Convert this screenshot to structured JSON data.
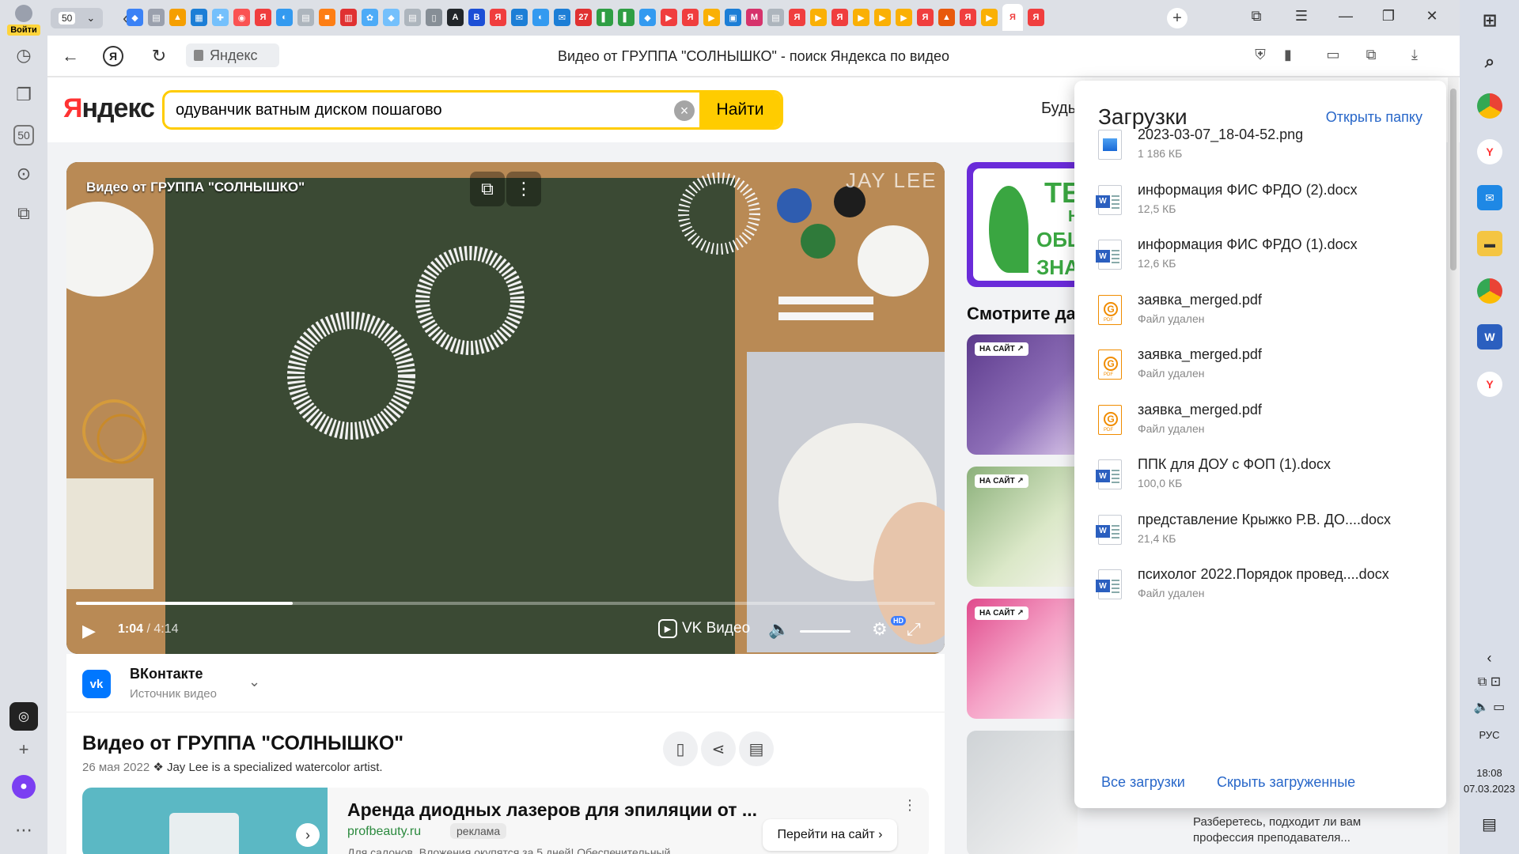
{
  "browser": {
    "login_label": "Войти",
    "tab_count": "50",
    "address_chip": "Яндекс",
    "page_title": "Видео от ГРУППА \"СОЛНЫШКО\" - поиск Яндекса по видео",
    "tab_icons": [
      {
        "name": "tab-icon-1",
        "color": "#3b82f6",
        "glyph": "◆"
      },
      {
        "name": "tab-icon-2",
        "color": "#9aa0ad",
        "glyph": "▤"
      },
      {
        "name": "tab-icon-3",
        "color": "#f59f00",
        "glyph": "▲"
      },
      {
        "name": "tab-icon-4",
        "color": "#1c7ed6",
        "glyph": "▦"
      },
      {
        "name": "tab-icon-5",
        "color": "#74c0fc",
        "glyph": "✚"
      },
      {
        "name": "tab-icon-6",
        "color": "#fa5252",
        "glyph": "◉"
      },
      {
        "name": "tab-icon-7",
        "color": "#f03e3e",
        "glyph": "Я"
      },
      {
        "name": "tab-icon-8",
        "color": "#339af0",
        "glyph": "◐"
      },
      {
        "name": "tab-icon-9",
        "color": "#adb5bd",
        "glyph": "▤"
      },
      {
        "name": "tab-icon-10",
        "color": "#fd7e14",
        "glyph": "■"
      },
      {
        "name": "tab-icon-11",
        "color": "#e03131",
        "glyph": "▥"
      },
      {
        "name": "tab-icon-12",
        "color": "#4dabf7",
        "glyph": "✿"
      },
      {
        "name": "tab-icon-13",
        "color": "#74c0fc",
        "glyph": "◆"
      },
      {
        "name": "tab-icon-14",
        "color": "#adb5bd",
        "glyph": "▤"
      },
      {
        "name": "tab-icon-15",
        "color": "#868e96",
        "glyph": "▯"
      },
      {
        "name": "tab-icon-16",
        "color": "#212529",
        "glyph": "A"
      },
      {
        "name": "tab-icon-17",
        "color": "#1c4fd6",
        "glyph": "B"
      },
      {
        "name": "tab-icon-18",
        "color": "#f03e3e",
        "glyph": "Я"
      },
      {
        "name": "tab-icon-19",
        "color": "#1c7ed6",
        "glyph": "✉"
      },
      {
        "name": "tab-icon-20",
        "color": "#339af0",
        "glyph": "◐"
      },
      {
        "name": "tab-icon-21",
        "color": "#1c7ed6",
        "glyph": "✉"
      },
      {
        "name": "tab-icon-22",
        "color": "#e03131",
        "glyph": "27"
      },
      {
        "name": "tab-icon-23",
        "color": "#2f9e44",
        "glyph": "▌"
      },
      {
        "name": "tab-icon-24",
        "color": "#2f9e44",
        "glyph": "▌"
      },
      {
        "name": "tab-icon-25",
        "color": "#339af0",
        "glyph": "◆"
      },
      {
        "name": "tab-icon-26",
        "color": "#f03e3e",
        "glyph": "▶"
      },
      {
        "name": "tab-icon-27",
        "color": "#f03e3e",
        "glyph": "Я"
      },
      {
        "name": "tab-icon-28",
        "color": "#fab005",
        "glyph": "▶"
      },
      {
        "name": "tab-icon-29",
        "color": "#1c7ed6",
        "glyph": "▣"
      },
      {
        "name": "tab-icon-30",
        "color": "#d6336c",
        "glyph": "M"
      },
      {
        "name": "tab-icon-31",
        "color": "#adb5bd",
        "glyph": "▤"
      },
      {
        "name": "tab-icon-32",
        "color": "#f03e3e",
        "glyph": "Я"
      },
      {
        "name": "tab-icon-33",
        "color": "#fab005",
        "glyph": "▶"
      },
      {
        "name": "tab-icon-34",
        "color": "#f03e3e",
        "glyph": "Я"
      },
      {
        "name": "tab-icon-35",
        "color": "#fab005",
        "glyph": "▶"
      },
      {
        "name": "tab-icon-36",
        "color": "#fab005",
        "glyph": "▶"
      },
      {
        "name": "tab-icon-37",
        "color": "#fab005",
        "glyph": "▶"
      },
      {
        "name": "tab-icon-38",
        "color": "#f03e3e",
        "glyph": "Я"
      },
      {
        "name": "tab-icon-39",
        "color": "#e8590c",
        "glyph": "▲"
      },
      {
        "name": "tab-icon-40",
        "color": "#f03e3e",
        "glyph": "Я"
      },
      {
        "name": "tab-icon-41",
        "color": "#fab005",
        "glyph": "▶"
      },
      {
        "name": "tab-icon-42",
        "color": "#f03e3e",
        "glyph": "Я"
      },
      {
        "name": "tab-icon-43",
        "color": "#f03e3e",
        "glyph": "Я"
      }
    ]
  },
  "search": {
    "logo": "Яндекс",
    "query": "одуванчик ватным диском пошагово",
    "button": "Найти",
    "header_right_text": "Будь"
  },
  "player": {
    "title": "Видео от ГРУППА \"СОЛНЫШКО\"",
    "watermark": "JAY LEE",
    "current_time": "1:04",
    "duration": "4:14",
    "progress": 0.252,
    "brand": "VK Видео",
    "hd_badge": "HD"
  },
  "source": {
    "icon_text": "vk",
    "name": "ВКонтакте",
    "subtitle": "Источник видео"
  },
  "video_info": {
    "title": "Видео от ГРУППА \"СОЛНЫШКО\"",
    "date": "26 мая 2022",
    "description": "Jay Lee is a specialized watercolor artist."
  },
  "ad": {
    "title": "Аренда диодных лазеров для эпиляции от ...",
    "site": "profbeauty.ru",
    "tag": "реклама",
    "description": "Для салонов. Вложения окупятся за 5 дней! Обеспечительный",
    "cta": "Перейти на сайт"
  },
  "right_column": {
    "banner": {
      "t1": "ТЕ",
      "t2": "Н",
      "t3": "ОБЩ",
      "t4": "ЗНА"
    },
    "watch_also": "Смотрите да",
    "thumb_tag": "НА САЙТ ↗",
    "caption": "Разберетесь, подходит ли вам профессия преподавателя..."
  },
  "downloads": {
    "title": "Загрузки",
    "open_folder": "Открыть папку",
    "items": [
      {
        "type": "png",
        "name": "2023-03-07_18-04-52.png",
        "sub": "1 186 КБ"
      },
      {
        "type": "docx",
        "name": "информация ФИС ФРДО (2).docx",
        "sub": "12,5 КБ"
      },
      {
        "type": "docx",
        "name": "информация ФИС ФРДО (1).docx",
        "sub": "12,6 КБ"
      },
      {
        "type": "pdf",
        "name": "заявка_merged.pdf",
        "sub": "Файл удален"
      },
      {
        "type": "pdf",
        "name": "заявка_merged.pdf",
        "sub": "Файл удален"
      },
      {
        "type": "pdf",
        "name": "заявка_merged.pdf",
        "sub": "Файл удален"
      },
      {
        "type": "docx",
        "name": "ППК для ДОУ с ФОП (1).docx",
        "sub": "100,0 КБ"
      },
      {
        "type": "docx",
        "name": "представление Крыжко Р.В. ДО....docx",
        "sub": "21,4 КБ"
      },
      {
        "type": "docx",
        "name": "психолог 2022.Порядок провед....docx",
        "sub": "Файл удален"
      }
    ],
    "all_downloads": "Все загрузки",
    "hide_downloaded": "Скрыть загруженные"
  },
  "taskbar": {
    "lang": "РУС",
    "time": "18:08",
    "date": "07.03.2023"
  }
}
